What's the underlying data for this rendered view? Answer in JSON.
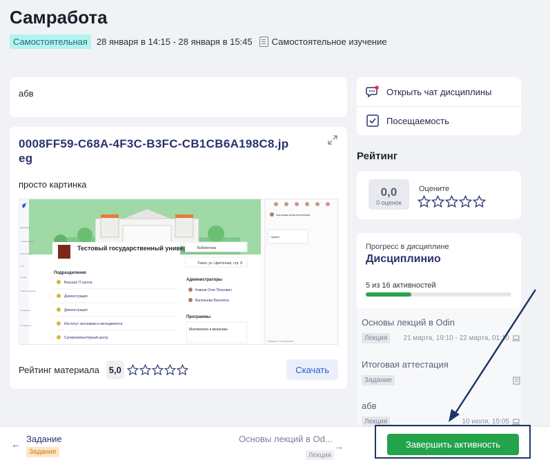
{
  "page": {
    "title": "Самработа"
  },
  "meta": {
    "type_badge": "Самостоятельная",
    "dates": "28 января в 14:15 - 28 января в 15:45",
    "mode": "Самостоятельное изучение"
  },
  "description": {
    "text": "абв"
  },
  "file": {
    "title": "0008FF59-C68A-4F3C-B3FC-CB1CB6A198C8.jpeg",
    "caption": "просто картинка",
    "rating_label": "Рейтинг материала",
    "rating_value": "5,0",
    "download_label": "Скачать"
  },
  "preview": {
    "university": "Тестовый государственный университет",
    "departments_heading": "Подразделения",
    "departments": [
      "Высшая IT школа",
      "Демонстрация",
      "Демонстрация",
      "Институт экономики и менеджмента",
      "Суперкомпьютерный центр"
    ],
    "library": "Библиотека",
    "address": "Томск, ул. Цветочная, стр. 8",
    "admins_heading": "Администраторы",
    "admins": [
      "Ковнев Олег Петрович",
      "Васильева Василиса"
    ],
    "programs_heading": "Программы",
    "program": "Математика и механика",
    "chat_user": "Антонова Анна Антоновна",
    "chat_msg": "Привет",
    "chat_input": "Введите сообщение",
    "sidebar": [
      "Дашборд",
      "Университеты",
      "Материалы",
      "Чат",
      "Поиск",
      "Класс Семинар",
      "Подборки",
      "Активность"
    ]
  },
  "actions": {
    "chat_label": "Открыть чат дисциплины",
    "attendance_label": "Посещаемость"
  },
  "rating": {
    "heading": "Рейтинг",
    "score": "0,0",
    "count": "0 оценок",
    "rate_label": "Оцените"
  },
  "progress": {
    "label": "Прогресс в дисциплине",
    "title": "Дисциплинио",
    "count": "5 из 16 активностей",
    "fraction": 0.3125,
    "items": [
      {
        "name": "Основы лекций в Odin",
        "tag": "Лекция",
        "date": "21 марта, 19:10 - 22 марта, 01:10"
      },
      {
        "name": "Итоговая аттестация",
        "tag": "Задание",
        "date": ""
      },
      {
        "name": "абв",
        "tag": "Лекция",
        "date": "10 июля, 15:05"
      }
    ]
  },
  "bottom": {
    "prev_title": "Задание",
    "prev_tag": "Задание",
    "next_title": "Основы лекций в Od...",
    "next_tag": "Лекция",
    "finish_label": "Завершить активность"
  },
  "colors": {
    "accent": "#2a5cc8",
    "title_navy": "#2b3270",
    "success": "#23a34a",
    "annotation": "#1d3566"
  }
}
